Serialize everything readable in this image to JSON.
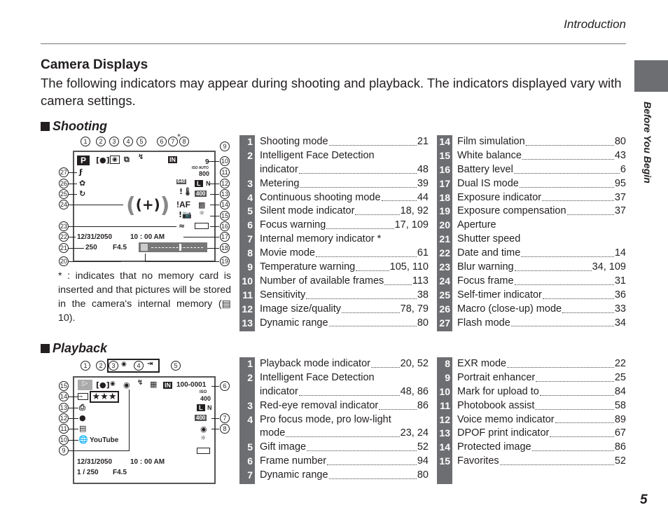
{
  "header": {
    "section": "Introduction",
    "side_tab": "Before You Begin",
    "page_number": "5"
  },
  "title": "Camera Displays",
  "intro": "The following indicators may appear during shooting and playback.  The indicators displayed vary with camera settings.",
  "shooting": {
    "heading": "Shooting",
    "callouts": [
      "1",
      "2",
      "3",
      "4",
      "5",
      "6",
      "7",
      "8",
      "9",
      "10",
      "11",
      "12",
      "13",
      "14",
      "15",
      "16",
      "17",
      "18",
      "19",
      "20",
      "21",
      "22",
      "23",
      "24",
      "25",
      "26",
      "27"
    ],
    "asterisk": "*",
    "screen": {
      "mode": "P",
      "memory": "IN",
      "frames": "9",
      "iso_label": "ISO AUTO",
      "iso": "800",
      "size": "L",
      "quality": "N",
      "movie": "640",
      "dr": "400",
      "focus_warning": "!AF",
      "date": "12/31/2050",
      "time": "10 : 00  AM",
      "shutter": "250",
      "aperture": "F4.5"
    },
    "footnote": "*  : indicates that no memory card is inserted and that pictures will be stored in the camera's internal memory (▤ 10).",
    "items": [
      {
        "n": "1",
        "label": "Shooting mode",
        "page": "21"
      },
      {
        "n": "2",
        "label": "Intelligent Face Detection",
        "label2": "indicator",
        "page": "48"
      },
      {
        "n": "3",
        "label": "Metering",
        "page": "39"
      },
      {
        "n": "4",
        "label": "Continuous shooting mode",
        "page": "44"
      },
      {
        "n": "5",
        "label": "Silent mode indicator",
        "page": "18, 92"
      },
      {
        "n": "6",
        "label": "Focus warning",
        "page": "17, 109"
      },
      {
        "n": "7",
        "label": "Internal memory indicator *",
        "page": ""
      },
      {
        "n": "8",
        "label": "Movie mode",
        "page": "61"
      },
      {
        "n": "9",
        "label": "Temperature warning",
        "page": "105, 110"
      },
      {
        "n": "10",
        "label": "Number of available frames",
        "page": "113"
      },
      {
        "n": "11",
        "label": "Sensitivity",
        "page": "38"
      },
      {
        "n": "12",
        "label": "Image size/quality",
        "page": "78, 79"
      },
      {
        "n": "13",
        "label": "Dynamic range",
        "page": "80"
      },
      {
        "n": "14",
        "label": "Film simulation",
        "page": "80"
      },
      {
        "n": "15",
        "label": "White balance",
        "page": "43"
      },
      {
        "n": "16",
        "label": "Battery level",
        "page": "6"
      },
      {
        "n": "17",
        "label": "Dual IS mode",
        "page": "95"
      },
      {
        "n": "18",
        "label": "Exposure indicator",
        "page": "37"
      },
      {
        "n": "19",
        "label": "Exposure compensation",
        "page": "37"
      },
      {
        "n": "20",
        "label": "Aperture",
        "page": ""
      },
      {
        "n": "21",
        "label": "Shutter speed",
        "page": ""
      },
      {
        "n": "22",
        "label": "Date and time",
        "page": "14"
      },
      {
        "n": "23",
        "label": "Blur warning",
        "page": "34, 109"
      },
      {
        "n": "24",
        "label": "Focus frame",
        "page": "31"
      },
      {
        "n": "25",
        "label": "Self-timer indicator",
        "page": "36"
      },
      {
        "n": "26",
        "label": "Macro (close-up) mode",
        "page": "33"
      },
      {
        "n": "27",
        "label": "Flash mode",
        "page": "34"
      }
    ]
  },
  "playback": {
    "heading": "Playback",
    "callouts": [
      "1",
      "2",
      "3",
      "4",
      "5",
      "6",
      "7",
      "8",
      "9",
      "10",
      "11",
      "12",
      "13",
      "14",
      "15"
    ],
    "screen": {
      "memory": "IN",
      "frame": "100-0001",
      "iso_label": "ISO",
      "iso": "400",
      "size": "L",
      "quality": "N",
      "dr": "400",
      "favorites": "★★★",
      "upload": "YouTube",
      "date": "12/31/2050",
      "time": "10 : 00  AM",
      "shutter": "1 / 250",
      "aperture": "F4.5"
    },
    "items": [
      {
        "n": "1",
        "label": "Playback mode indicator",
        "page": "20, 52"
      },
      {
        "n": "2",
        "label": "Intelligent Face Detection",
        "label2": "indicator",
        "page": "48, 86"
      },
      {
        "n": "3",
        "label": "Red-eye removal indicator",
        "page": "86"
      },
      {
        "n": "4",
        "label": "Pro focus mode, pro low-light",
        "label2": "mode",
        "page": "23, 24"
      },
      {
        "n": "5",
        "label": "Gift image",
        "page": "52"
      },
      {
        "n": "6",
        "label": "Frame number",
        "page": "94"
      },
      {
        "n": "7",
        "label": "Dynamic range",
        "page": "80"
      },
      {
        "n": "8",
        "label": "EXR mode",
        "page": "22"
      },
      {
        "n": "9",
        "label": "Portrait enhancer",
        "page": "25"
      },
      {
        "n": "10",
        "label": "Mark for upload to",
        "page": "84"
      },
      {
        "n": "11",
        "label": "Photobook assist",
        "page": "58"
      },
      {
        "n": "12",
        "label": "Voice memo indicator",
        "page": "89"
      },
      {
        "n": "13",
        "label": "DPOF print indicator",
        "page": "67"
      },
      {
        "n": "14",
        "label": "Protected image",
        "page": "86"
      },
      {
        "n": "15",
        "label": "Favorites",
        "page": "52"
      }
    ]
  },
  "colors": {
    "strip": "#6d6e71",
    "text": "#231f20"
  }
}
